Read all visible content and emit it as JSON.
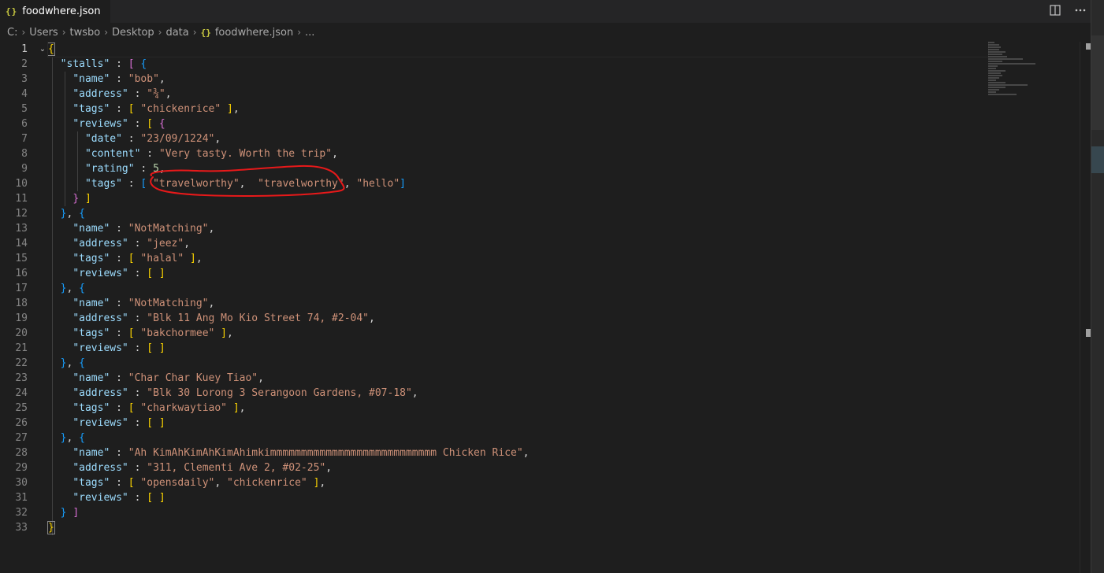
{
  "tab": {
    "icon": "{}",
    "title": "foodwhere.json",
    "close": "×"
  },
  "tab_actions": {
    "split_icon": "split-editor-icon",
    "more_icon": "more-actions-icon"
  },
  "breadcrumb": {
    "items": [
      "C:",
      "Users",
      "twsbo",
      "Desktop",
      "data"
    ],
    "file_icon": "{}",
    "file": "foodwhere.json",
    "ellipsis": "..."
  },
  "editor": {
    "active_line": 1,
    "line_numbers": [
      "1",
      "2",
      "3",
      "4",
      "5",
      "6",
      "7",
      "8",
      "9",
      "10",
      "11",
      "12",
      "13",
      "14",
      "15",
      "16",
      "17",
      "18",
      "19",
      "20",
      "21",
      "22",
      "23",
      "24",
      "25",
      "26",
      "27",
      "28",
      "29",
      "30",
      "31",
      "32",
      "33"
    ],
    "annotation": "red freehand circle around tag values on line 10",
    "annotation_color": "#e8191a"
  },
  "code": {
    "l1": "{",
    "l2_key": "\"stalls\"",
    "l2_colon": " : ",
    "l2_open": "[",
    "l2_brace": "{",
    "l3_key": "\"name\"",
    "l3_val": "\"bob\"",
    "l4_key": "\"address\"",
    "l4_val": "\"¾\"",
    "l5_key": "\"tags\"",
    "l5_val": "\"chickenrice\"",
    "l6_key": "\"reviews\"",
    "l7_key": "\"date\"",
    "l7_val": "\"23/09/1224\"",
    "l8_key": "\"content\"",
    "l8_val": "\"Very tasty. Worth the trip\"",
    "l9_key": "\"rating\"",
    "l9_val": "5",
    "l10_key": "\"tags\"",
    "l10_v1": "\"travelworthy\"",
    "l10_v2": "\"travelworthy\"",
    "l10_v3": "\"hello\"",
    "l13_val": "\"NotMatching\"",
    "l14_val": "\"jeez\"",
    "l15_val": "\"halal\"",
    "l18_val": "\"NotMatching\"",
    "l19_val": "\"Blk 11 Ang Mo Kio Street 74, #2-04\"",
    "l20_val": "\"bakchormee\"",
    "l23_val": "\"Char Char Kuey Tiao\"",
    "l24_val": "\"Blk 30 Lorong 3 Serangoon Gardens, #07-18\"",
    "l25_val": "\"charkwaytiao\"",
    "l28_val": "\"Ah KimAhKimAhKimAhimkimmmmmmmmmmmmmmmmmmmmmmmmmmm Chicken Rice\"",
    "l29_val": "\"311, Clementi Ave 2, #02-25\"",
    "l30_v1": "\"opensdaily\"",
    "l30_v2": "\"chickenrice\"",
    "name_key": "\"name\"",
    "address_key": "\"address\"",
    "tags_key": "\"tags\"",
    "reviews_key": "\"reviews\""
  }
}
